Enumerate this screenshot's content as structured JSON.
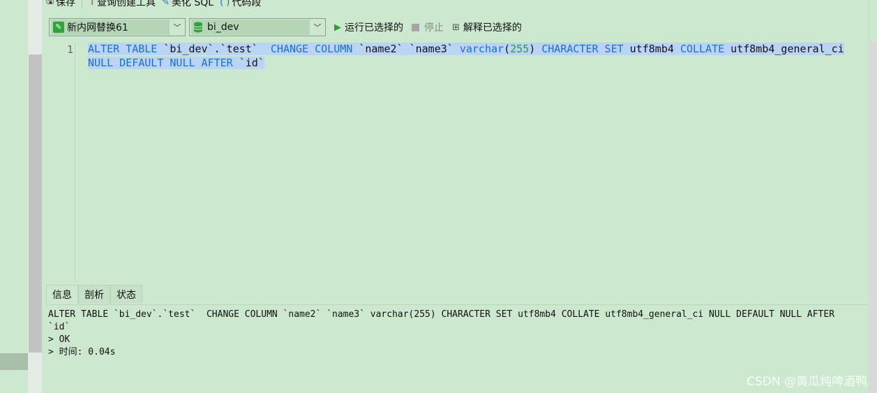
{
  "toolbar": {
    "save_label": "保存",
    "query_builder_label": "查询创建工具",
    "beautify_label": "美化 SQL",
    "snippet_label": "代码段"
  },
  "connection": {
    "selected": "新内网替换61"
  },
  "database": {
    "selected": "bi_dev"
  },
  "actions": {
    "run_selected": "运行已选择的",
    "stop": "停止",
    "explain_selected": "解释已选择的"
  },
  "editor": {
    "line_number": "1",
    "line1": {
      "p1": "ALTER TABLE",
      "p2": " `bi_dev`.`test`  ",
      "p3": "CHANGE COLUMN",
      "p4": " `name2` `name3` ",
      "p5": "varchar",
      "p6": "(",
      "p7": "255",
      "p8": ") ",
      "p9": "CHARACTER SET",
      "p10": " utf8mb4 ",
      "p11": "COLLATE",
      "p12": " utf8mb4_general_ci"
    },
    "line2": {
      "p1": "NULL DEFAULT NULL AFTER",
      "p2": " `id`"
    }
  },
  "result_tabs": [
    "信息",
    "剖析",
    "状态"
  ],
  "result": {
    "line1": "ALTER TABLE `bi_dev`.`test`  CHANGE COLUMN `name2` `name3` varchar(255) CHARACTER SET utf8mb4 COLLATE utf8mb4_general_ci NULL DEFAULT NULL AFTER",
    "line2": "`id`",
    "line3": "> OK",
    "line4": "> 时间: 0.04s"
  },
  "watermark": "CSDN @黄瓜炖啤酒鸭"
}
